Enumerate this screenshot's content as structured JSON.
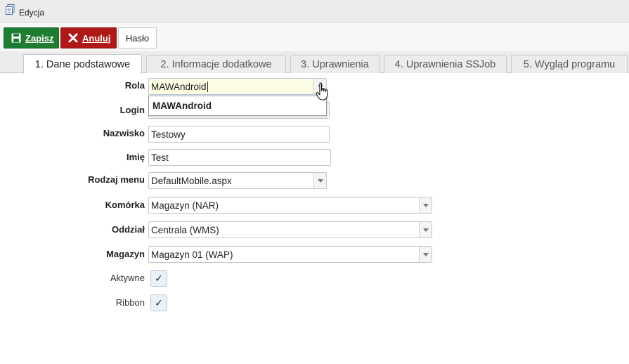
{
  "window": {
    "title": "Edycja"
  },
  "toolbar": {
    "save_label": "Zapisz",
    "cancel_label": "Anuluj",
    "password_label": "Hasło"
  },
  "tabs": [
    {
      "label": "1. Dane podstawowe",
      "active": true
    },
    {
      "label": "2. Informacje dodatkowe",
      "active": false
    },
    {
      "label": "3. Uprawnienia",
      "active": false
    },
    {
      "label": "4. Uprawnienia SSJob",
      "active": false
    },
    {
      "label": "5. Wygląd programu",
      "active": false
    }
  ],
  "form": {
    "rola": {
      "label": "Rola",
      "value": "MAWAndroid",
      "dropdown_option": "MAWAndroid"
    },
    "login": {
      "label": "Login",
      "value": ""
    },
    "nazwisko": {
      "label": "Nazwisko",
      "value": "Testowy"
    },
    "imie": {
      "label": "Imię",
      "value": "Test"
    },
    "rodzaj_menu": {
      "label": "Rodzaj menu",
      "value": "DefaultMobile.aspx"
    },
    "komorka": {
      "label": "Komórka",
      "value": "Magazyn (NAR)"
    },
    "oddzial": {
      "label": "Oddział",
      "value": "Centrala (WMS)"
    },
    "magazyn": {
      "label": "Magazyn",
      "value": "Magazyn 01 (WAP)"
    },
    "aktywne": {
      "label": "Aktywne",
      "checked": true,
      "mark": "✓"
    },
    "ribbon": {
      "label": "Ribbon",
      "checked": true,
      "mark": "✓"
    }
  },
  "colors": {
    "save": "#1e7d32",
    "cancel": "#b01717",
    "active_field": "#fdfde4"
  },
  "icons": {
    "window": "document-icon",
    "save": "floppy-icon",
    "cancel": "x-icon",
    "cursor": "hand-pointer-icon"
  }
}
